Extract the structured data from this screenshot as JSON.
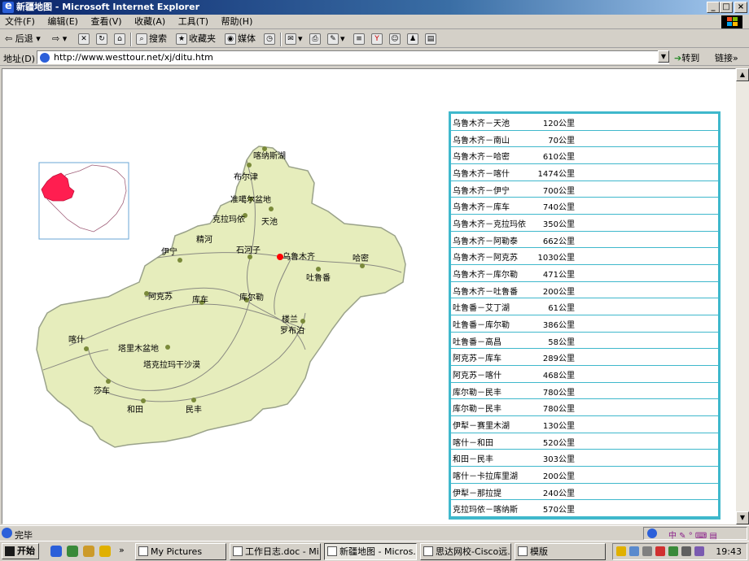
{
  "window": {
    "title": "新疆地图 - Microsoft Internet Explorer"
  },
  "menu": [
    "文件(F)",
    "编辑(E)",
    "查看(V)",
    "收藏(A)",
    "工具(T)",
    "帮助(H)"
  ],
  "toolbar": {
    "back": "后退",
    "search": "搜索",
    "favorites": "收藏夹",
    "media": "媒体"
  },
  "address": {
    "label": "地址(D)",
    "url": "http://www.westtour.net/xj/ditu.htm",
    "go": "转到",
    "links": "链接"
  },
  "map": {
    "places": [
      "喀纳斯湖",
      "布尔津",
      "准噶尔盆地",
      "克拉玛依",
      "天池",
      "精河",
      "石河子",
      "乌鲁木齐",
      "伊宁",
      "哈密",
      "吐鲁番",
      "阿克苏",
      "库车",
      "库尔勒",
      "楼兰",
      "罗布泊",
      "喀什",
      "塔里木盆地",
      "塔克拉玛干沙漠",
      "莎车",
      "和田",
      "民丰"
    ]
  },
  "distances": [
    {
      "route": "乌鲁木齐－天池",
      "dist": "120公里"
    },
    {
      "route": "乌鲁木齐－南山",
      "dist": "70公里"
    },
    {
      "route": "乌鲁木齐－哈密",
      "dist": "610公里"
    },
    {
      "route": "乌鲁木齐－喀什",
      "dist": "1474公里"
    },
    {
      "route": "乌鲁木齐－伊宁",
      "dist": "700公里"
    },
    {
      "route": "乌鲁木齐－库车",
      "dist": "740公里"
    },
    {
      "route": "乌鲁木齐－克拉玛依",
      "dist": "350公里"
    },
    {
      "route": "乌鲁木齐－阿勒泰",
      "dist": "662公里"
    },
    {
      "route": "乌鲁木齐－阿克苏",
      "dist": "1030公里"
    },
    {
      "route": "乌鲁木齐－库尔勒",
      "dist": "471公里"
    },
    {
      "route": "乌鲁木齐－吐鲁番",
      "dist": "200公里"
    },
    {
      "route": "吐鲁番－艾丁湖",
      "dist": "61公里"
    },
    {
      "route": "吐鲁番－库尔勒",
      "dist": "386公里"
    },
    {
      "route": "吐鲁番－高昌",
      "dist": "58公里"
    },
    {
      "route": "阿克苏－库车",
      "dist": "289公里"
    },
    {
      "route": "阿克苏－喀什",
      "dist": "468公里"
    },
    {
      "route": "库尔勒－民丰",
      "dist": "780公里"
    },
    {
      "route": "库尔勒－民丰",
      "dist": "780公里"
    },
    {
      "route": "伊犁－赛里木湖",
      "dist": "130公里"
    },
    {
      "route": "喀什－和田",
      "dist": "520公里"
    },
    {
      "route": "和田－民丰",
      "dist": "303公里"
    },
    {
      "route": "喀什－卡拉库里湖",
      "dist": "200公里"
    },
    {
      "route": "伊犁－那拉提",
      "dist": "240公里"
    },
    {
      "route": "克拉玛依－喀纳斯",
      "dist": "570公里"
    }
  ],
  "status": {
    "text": "完毕"
  },
  "taskbar": {
    "start": "开始",
    "items": [
      "My Pictures",
      "工作日志.doc - Mi...",
      "新疆地图 - Micros...",
      "思达网校-Cisco远...",
      "模版"
    ],
    "clock": "19:43"
  },
  "colors": {
    "titlebar": "#0a246a",
    "table_border": "#3fb8cc",
    "map_fill": "#e6edbc",
    "highlight_region": "#ff1e50"
  }
}
